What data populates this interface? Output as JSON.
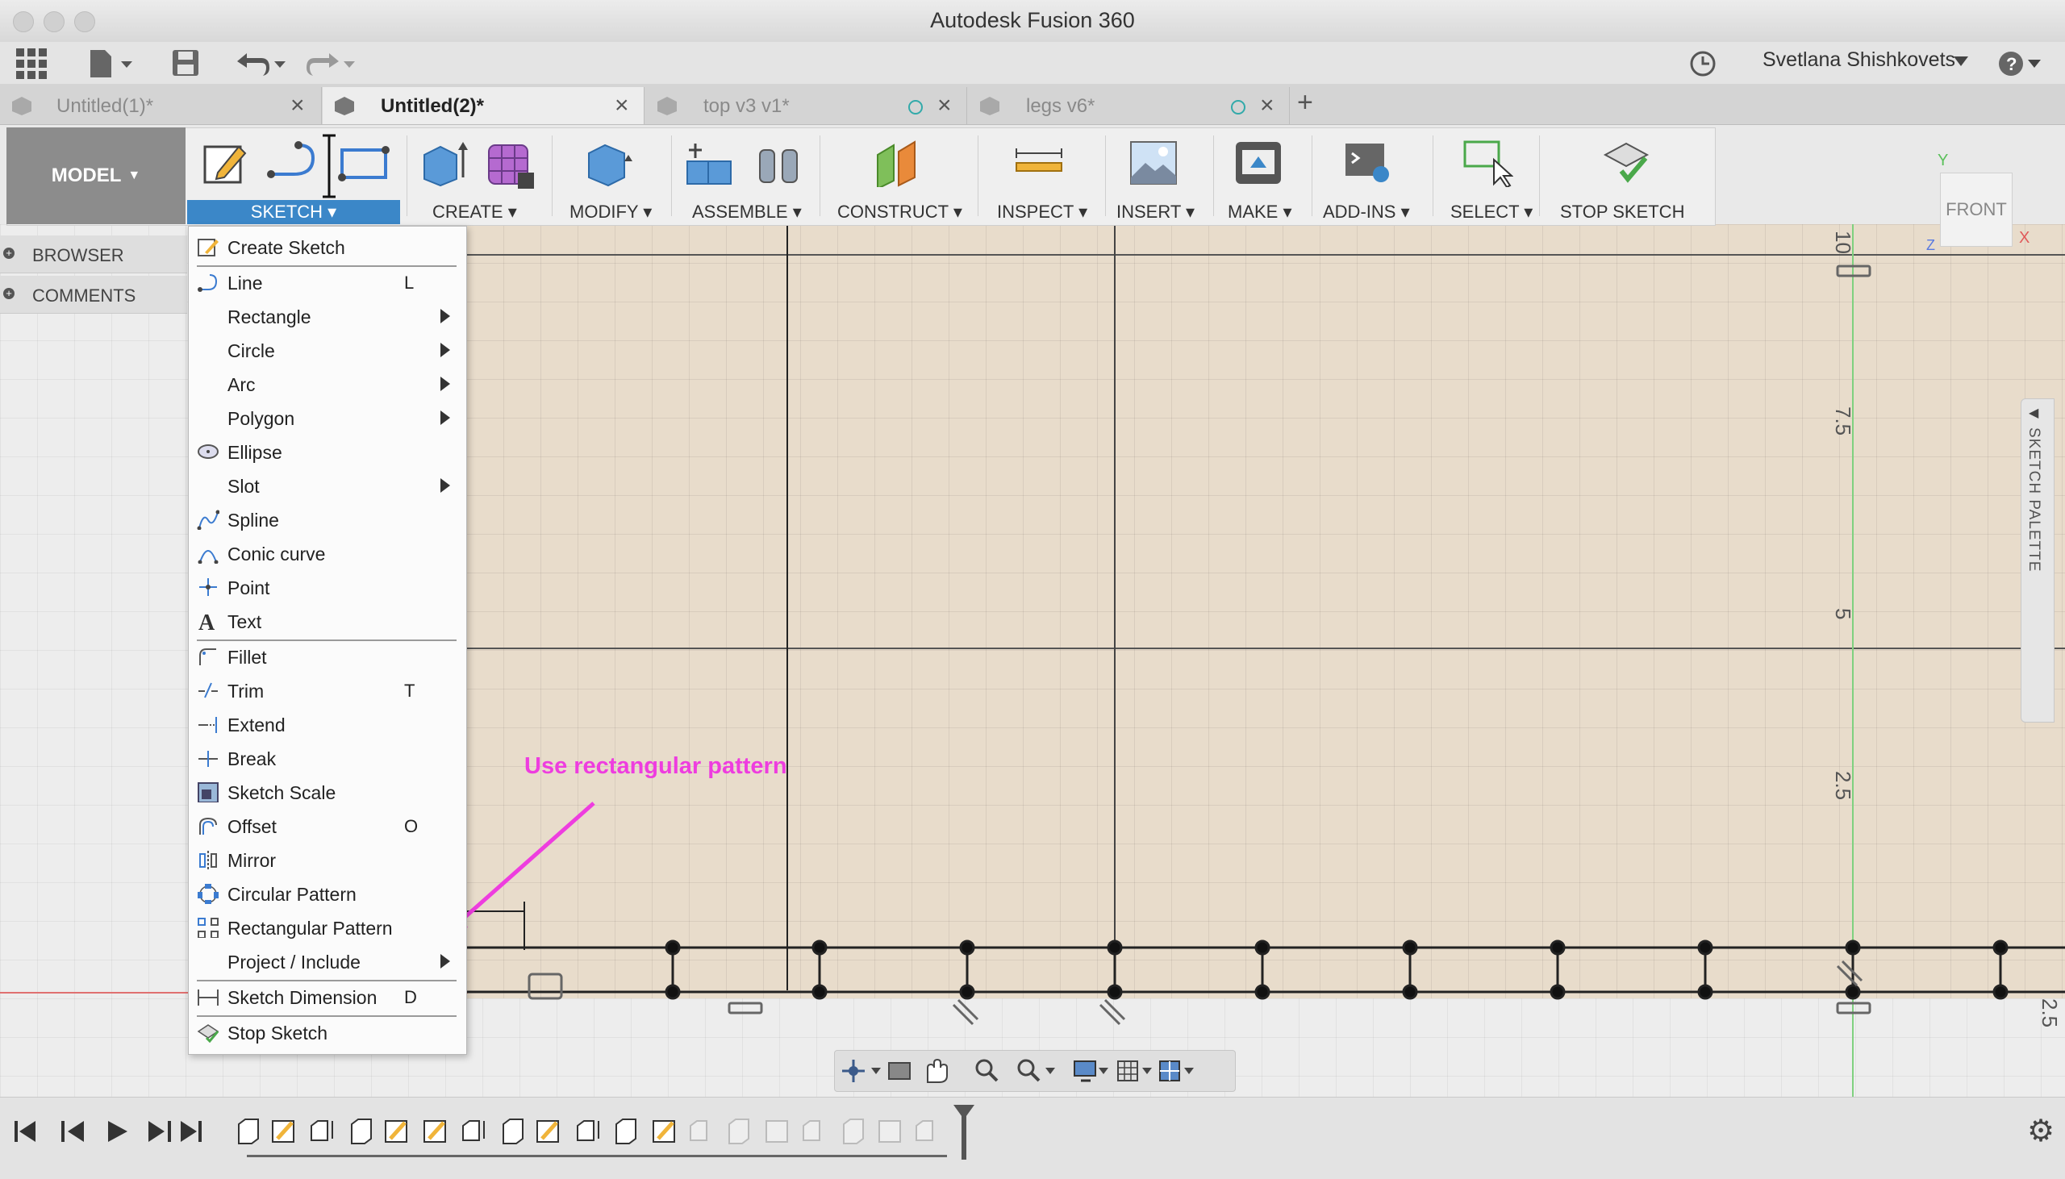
{
  "window": {
    "title": "Autodesk Fusion 360"
  },
  "quick_access": {
    "user_name": "Svetlana Shishkovets"
  },
  "tabs": [
    {
      "label": "Untitled(1)*",
      "active": false
    },
    {
      "label": "Untitled(2)*",
      "active": true
    },
    {
      "label": "top v3 v1*",
      "active": false
    },
    {
      "label": "legs v6*",
      "active": false
    }
  ],
  "workspace": {
    "label": "MODEL"
  },
  "ribbon": {
    "sketch": "SKETCH",
    "create": "CREATE",
    "modify": "MODIFY",
    "assemble": "ASSEMBLE",
    "construct": "CONSTRUCT",
    "inspect": "INSPECT",
    "insert": "INSERT",
    "make": "MAKE",
    "add_ins": "ADD-INS",
    "select": "SELECT",
    "stop_sketch": "STOP SKETCH"
  },
  "side_panel": {
    "browser": "BROWSER",
    "comments": "COMMENTS"
  },
  "viewcube": {
    "face": "FRONT",
    "axis_y": "Y",
    "axis_x": "X",
    "axis_z": "Z"
  },
  "palette": {
    "label": "SKETCH PALETTE"
  },
  "rulers": {
    "r10": "10",
    "r75": "7.5",
    "r5": "5",
    "r25": "2.5",
    "r25b": "2.5"
  },
  "sketch_menu": {
    "items": [
      {
        "label": "Create Sketch",
        "shortcut": "",
        "submenu": false,
        "icon": "create-sketch-icon"
      },
      {
        "label": "Line",
        "shortcut": "L",
        "submenu": false,
        "icon": "line-icon"
      },
      {
        "label": "Rectangle",
        "shortcut": "",
        "submenu": true,
        "icon": ""
      },
      {
        "label": "Circle",
        "shortcut": "",
        "submenu": true,
        "icon": ""
      },
      {
        "label": "Arc",
        "shortcut": "",
        "submenu": true,
        "icon": ""
      },
      {
        "label": "Polygon",
        "shortcut": "",
        "submenu": true,
        "icon": ""
      },
      {
        "label": "Ellipse",
        "shortcut": "",
        "submenu": false,
        "icon": "ellipse-icon"
      },
      {
        "label": "Slot",
        "shortcut": "",
        "submenu": true,
        "icon": ""
      },
      {
        "label": "Spline",
        "shortcut": "",
        "submenu": false,
        "icon": "spline-icon"
      },
      {
        "label": "Conic curve",
        "shortcut": "",
        "submenu": false,
        "icon": "conic-curve-icon"
      },
      {
        "label": "Point",
        "shortcut": "",
        "submenu": false,
        "icon": "point-icon"
      },
      {
        "label": "Text",
        "shortcut": "",
        "submenu": false,
        "icon": "text-icon"
      },
      {
        "label": "Fillet",
        "shortcut": "",
        "submenu": false,
        "icon": "fillet-icon"
      },
      {
        "label": "Trim",
        "shortcut": "T",
        "submenu": false,
        "icon": "trim-icon"
      },
      {
        "label": "Extend",
        "shortcut": "",
        "submenu": false,
        "icon": "extend-icon"
      },
      {
        "label": "Break",
        "shortcut": "",
        "submenu": false,
        "icon": "break-icon"
      },
      {
        "label": "Sketch Scale",
        "shortcut": "",
        "submenu": false,
        "icon": "sketch-scale-icon"
      },
      {
        "label": "Offset",
        "shortcut": "O",
        "submenu": false,
        "icon": "offset-icon"
      },
      {
        "label": "Mirror",
        "shortcut": "",
        "submenu": false,
        "icon": "mirror-icon"
      },
      {
        "label": "Circular Pattern",
        "shortcut": "",
        "submenu": false,
        "icon": "circular-pattern-icon"
      },
      {
        "label": "Rectangular Pattern",
        "shortcut": "",
        "submenu": false,
        "icon": "rectangular-pattern-icon"
      },
      {
        "label": "Project / Include",
        "shortcut": "",
        "submenu": true,
        "icon": ""
      },
      {
        "label": "Sketch Dimension",
        "shortcut": "D",
        "submenu": false,
        "icon": "sketch-dimension-icon"
      },
      {
        "label": "Stop Sketch",
        "shortcut": "",
        "submenu": false,
        "icon": "stop-sketch-icon"
      }
    ]
  },
  "annotation": {
    "text": "Use rectangular pattern",
    "color": "#ee3ddf"
  },
  "colors": {
    "accent": "#3b87c8",
    "sketch_plane": "#e8dccb",
    "annotation": "#ee3ddf"
  }
}
